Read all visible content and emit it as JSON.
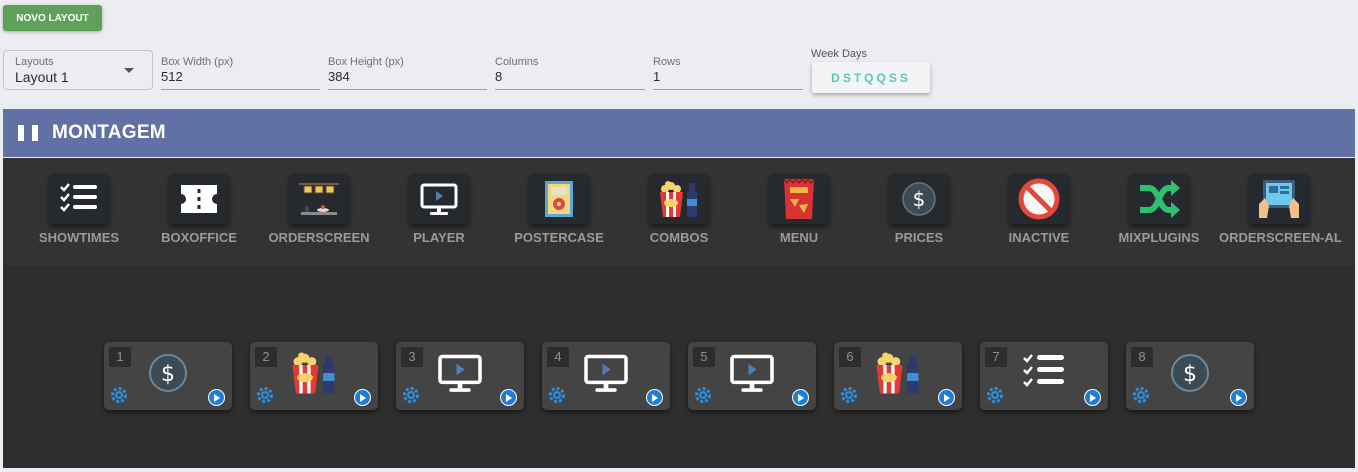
{
  "toolbar": {
    "new_layout_label": "NOVO LAYOUT"
  },
  "settings": {
    "layouts": {
      "label": "Layouts",
      "value": "Layout 1"
    },
    "box_width": {
      "label": "Box Width (px)",
      "value": "512"
    },
    "box_height": {
      "label": "Box Height (px)",
      "value": "384"
    },
    "columns": {
      "label": "Columns",
      "value": "8"
    },
    "rows": {
      "label": "Rows",
      "value": "1"
    },
    "week_days": {
      "label": "Week Days",
      "value": "DSTQQSS"
    }
  },
  "header": {
    "title": "MONTAGEM"
  },
  "plugins": [
    {
      "label": "SHOWTIMES",
      "icon": "checklist-icon"
    },
    {
      "label": "BOXOFFICE",
      "icon": "ticket-icon"
    },
    {
      "label": "ORDERSCREEN",
      "icon": "orderscreen-icon"
    },
    {
      "label": "PLAYER",
      "icon": "monitor-play-icon"
    },
    {
      "label": "POSTERCASE",
      "icon": "poster-icon"
    },
    {
      "label": "COMBOS",
      "icon": "popcorn-drink-icon"
    },
    {
      "label": "MENU",
      "icon": "snack-bag-icon"
    },
    {
      "label": "PRICES",
      "icon": "dollar-circle-icon"
    },
    {
      "label": "INACTIVE",
      "icon": "prohibited-icon"
    },
    {
      "label": "MIXPLUGINS",
      "icon": "shuffle-icon"
    },
    {
      "label": "ORDERSCREEN-AL",
      "icon": "tablet-hands-icon"
    }
  ],
  "boxes": [
    {
      "number": "1",
      "icon": "dollar-circle-icon"
    },
    {
      "number": "2",
      "icon": "popcorn-drink-icon"
    },
    {
      "number": "3",
      "icon": "monitor-play-icon"
    },
    {
      "number": "4",
      "icon": "monitor-play-icon"
    },
    {
      "number": "5",
      "icon": "monitor-play-icon"
    },
    {
      "number": "6",
      "icon": "popcorn-drink-icon"
    },
    {
      "number": "7",
      "icon": "checklist-icon"
    },
    {
      "number": "8",
      "icon": "dollar-circle-icon"
    }
  ],
  "colors": {
    "header_bg": "#6171a5",
    "new_button": "#5fa05a",
    "week_days_text": "#5cc8b4",
    "play_button": "#1f7fd8",
    "gear": "#2b8fe0"
  }
}
